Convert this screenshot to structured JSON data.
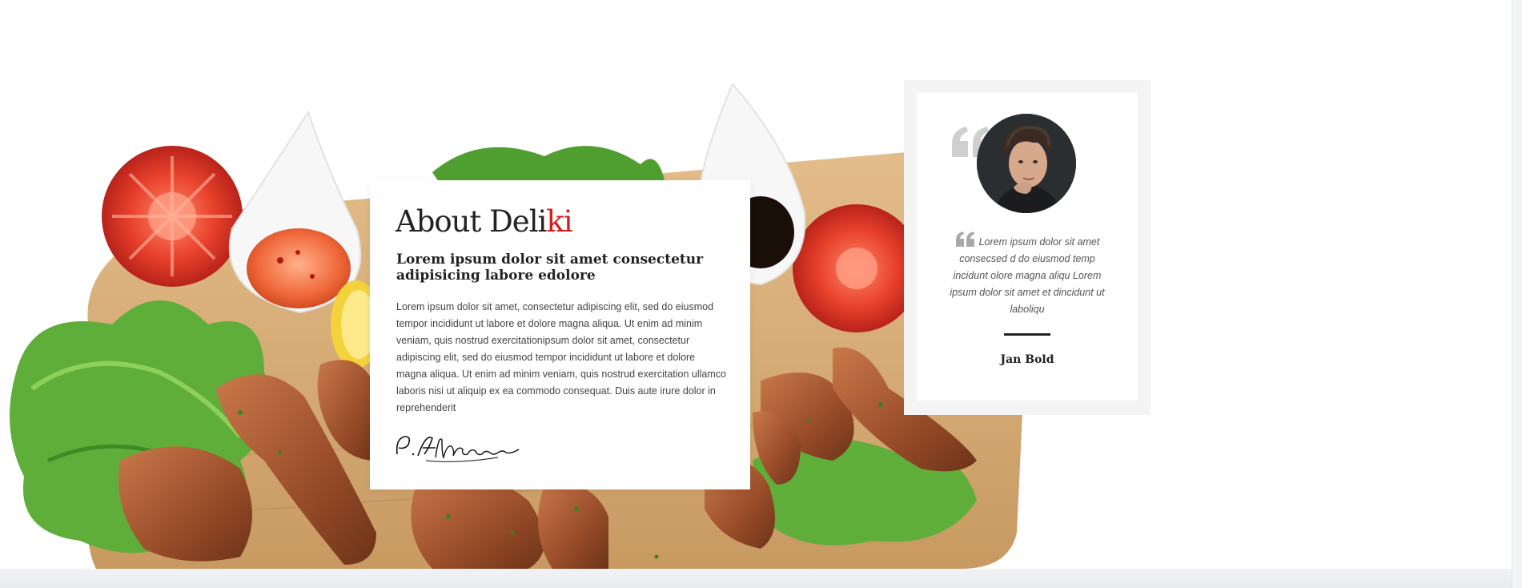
{
  "about": {
    "title_prefix": "About Deli",
    "title_accent": "ki",
    "subtitle": "Lorem ipsum dolor sit amet consectetur adipisicing labore edolore",
    "body": "Lorem ipsum dolor sit amet, consectetur adipiscing elit, sed do eiusmod tempor incididunt ut labore et dolore magna aliqua. Ut enim ad minim veniam, quis nostrud exercitationipsum dolor sit amet, consectetur adipiscing elit, sed do eiusmod tempor incididunt ut labore et dolore magna aliqua. Ut enim ad minim veniam, quis nostrud exercitation ullamco laboris nisi ut aliquip ex ea commodo consequat. Duis aute irure dolor in reprehenderit",
    "signature_icon": "handwritten-signature"
  },
  "testimonial": {
    "quote_icon": "quote-icon",
    "text": "Lorem ipsum dolor sit amet consecsed d do eiusmod temp incidunt olore magna aliqu Lorem ipsum dolor sit amet et dincidunt ut laboliqu",
    "author": "Jan Bold"
  },
  "colors": {
    "accent": "#d61b1b",
    "heading": "#222222",
    "body_text": "#444444",
    "frame": "#f4f4f4",
    "quote_gray": "#cfcfcf"
  }
}
